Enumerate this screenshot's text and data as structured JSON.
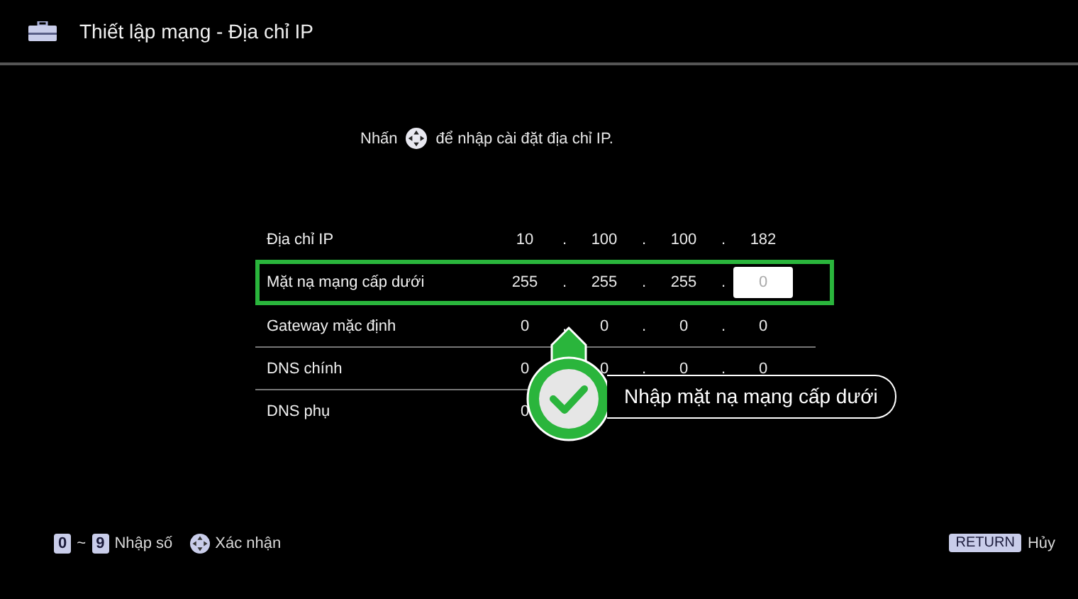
{
  "header": {
    "title": "Thiết lập mạng - Địa chỉ IP"
  },
  "instruction": {
    "before": "Nhấn",
    "after": "để nhập cài đặt địa chỉ IP."
  },
  "rows": [
    {
      "label": "Địa chỉ IP",
      "selected": false,
      "octets": [
        {
          "kind": "value",
          "value": "10"
        },
        {
          "kind": "value",
          "separator": ".",
          "value": "100"
        },
        {
          "kind": "value",
          "separator": ".",
          "value": "100"
        },
        {
          "kind": "value",
          "separator": ".",
          "value": "182"
        }
      ]
    },
    {
      "label": "Mặt nạ mạng cấp dưới",
      "selected": true,
      "octets": [
        {
          "kind": "value",
          "value": "255"
        },
        {
          "kind": "value",
          "separator": ".",
          "value": "255"
        },
        {
          "kind": "value",
          "separator": ".",
          "value": "255"
        },
        {
          "kind": "input",
          "separator": ".",
          "placeholder": "0"
        }
      ]
    },
    {
      "label": "Gateway mặc định",
      "selected": false,
      "octets": [
        {
          "kind": "value",
          "value": "0"
        },
        {
          "kind": "value",
          "separator": ".",
          "value": "0"
        },
        {
          "kind": "value",
          "separator": ".",
          "value": "0"
        },
        {
          "kind": "value",
          "separator": ".",
          "value": "0"
        }
      ]
    },
    {
      "label": "DNS chính",
      "selected": false,
      "octets": [
        {
          "kind": "value",
          "value": "0"
        },
        {
          "kind": "value",
          "value": "0"
        },
        {
          "kind": "value",
          "separator": ".",
          "value": "0"
        },
        {
          "kind": "value",
          "separator": ".",
          "value": "0"
        }
      ]
    },
    {
      "label": "DNS phụ",
      "selected": false,
      "octets": [
        {
          "kind": "value",
          "value": "0"
        }
      ]
    }
  ],
  "annotation": {
    "text": "Nhập mặt nạ mạng cấp dưới"
  },
  "footer": {
    "hints": [
      {
        "kind": "range",
        "from": "0",
        "sep": "~",
        "to": "9",
        "label": "Nhập số"
      },
      {
        "kind": "dpad",
        "label": "Xác nhận"
      }
    ],
    "back": {
      "key": "RETURN",
      "label": "Hủy"
    }
  }
}
